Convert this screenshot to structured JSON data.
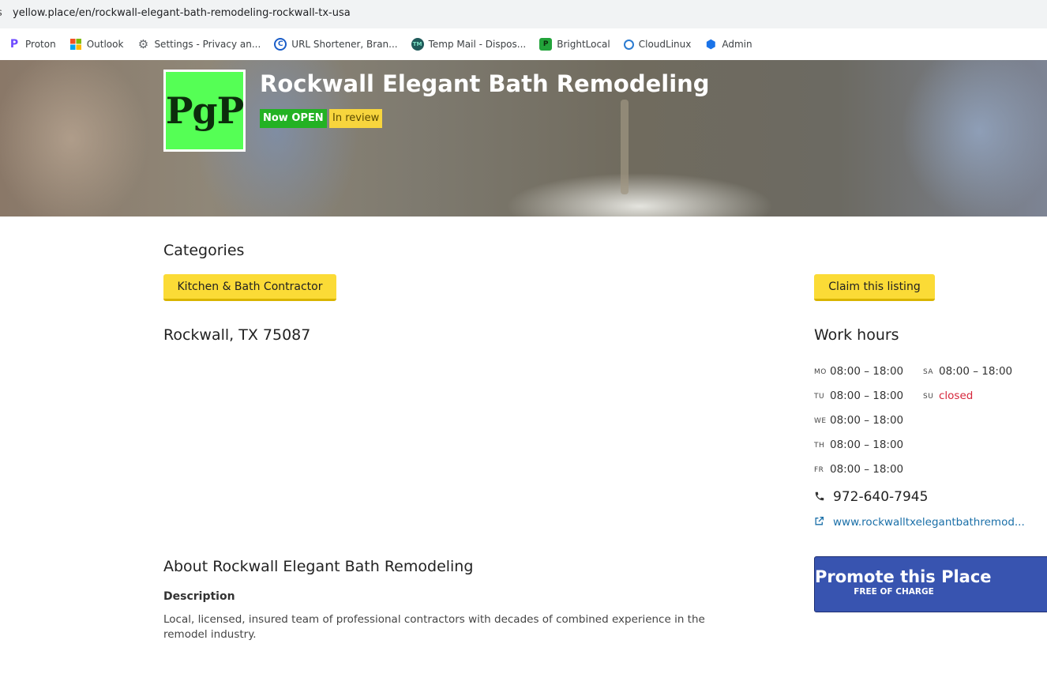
{
  "browser": {
    "url": "yellow.place/en/rockwall-elegant-bath-remodeling-rockwall-tx-usa",
    "bookmarks": [
      {
        "label": "Proton",
        "icon": "proton-icon",
        "color": "#6d4aff",
        "glyph": "P"
      },
      {
        "label": "Outlook",
        "icon": "microsoft-icon",
        "color": "#f25022",
        "glyph": "▦"
      },
      {
        "label": "Settings - Privacy an...",
        "icon": "gear-icon",
        "color": "#5f6368",
        "glyph": "⚙"
      },
      {
        "label": "URL Shortener, Bran...",
        "icon": "link-c-icon",
        "color": "#1a5dc8",
        "glyph": "C"
      },
      {
        "label": "Temp Mail - Dispos...",
        "icon": "temp-mail-icon",
        "color": "#1f5a5a",
        "glyph": "●"
      },
      {
        "label": "BrightLocal",
        "icon": "brightlocal-icon",
        "color": "#22a33a",
        "glyph": "P"
      },
      {
        "label": "CloudLinux",
        "icon": "cloudlinux-icon",
        "color": "#2b7bd1",
        "glyph": "◐"
      },
      {
        "label": "Admin",
        "icon": "admin-icon",
        "color": "#1a73e8",
        "glyph": "⬢"
      }
    ]
  },
  "business": {
    "logo_text": "PgP",
    "name": "Rockwall Elegant Bath Remodeling",
    "status_open": "Now OPEN",
    "status_review": "In review"
  },
  "categories": {
    "heading": "Categories",
    "item": "Kitchen & Bath Contractor"
  },
  "claim_label": "Claim this listing",
  "address": "Rockwall, TX 75087",
  "hours": {
    "heading": "Work hours",
    "left": [
      {
        "day": "MO",
        "time": "08:00 – 18:00"
      },
      {
        "day": "TU",
        "time": "08:00 – 18:00"
      },
      {
        "day": "WE",
        "time": "08:00 – 18:00"
      },
      {
        "day": "TH",
        "time": "08:00 – 18:00"
      },
      {
        "day": "FR",
        "time": "08:00 – 18:00"
      }
    ],
    "right": [
      {
        "day": "SA",
        "time": "08:00 – 18:00"
      },
      {
        "day": "SU",
        "time": "closed"
      }
    ]
  },
  "contact": {
    "phone": "972-640-7945",
    "website": "www.rockwalltxelegantbathremod..."
  },
  "promote": {
    "title": "Promote this Place",
    "subtitle": "FREE OF CHARGE"
  },
  "about": {
    "heading": "About Rockwall Elegant Bath Remodeling",
    "desc_heading": "Description",
    "description": "Local, licensed, insured team of professional contractors with decades of combined experience in the remodel industry."
  }
}
